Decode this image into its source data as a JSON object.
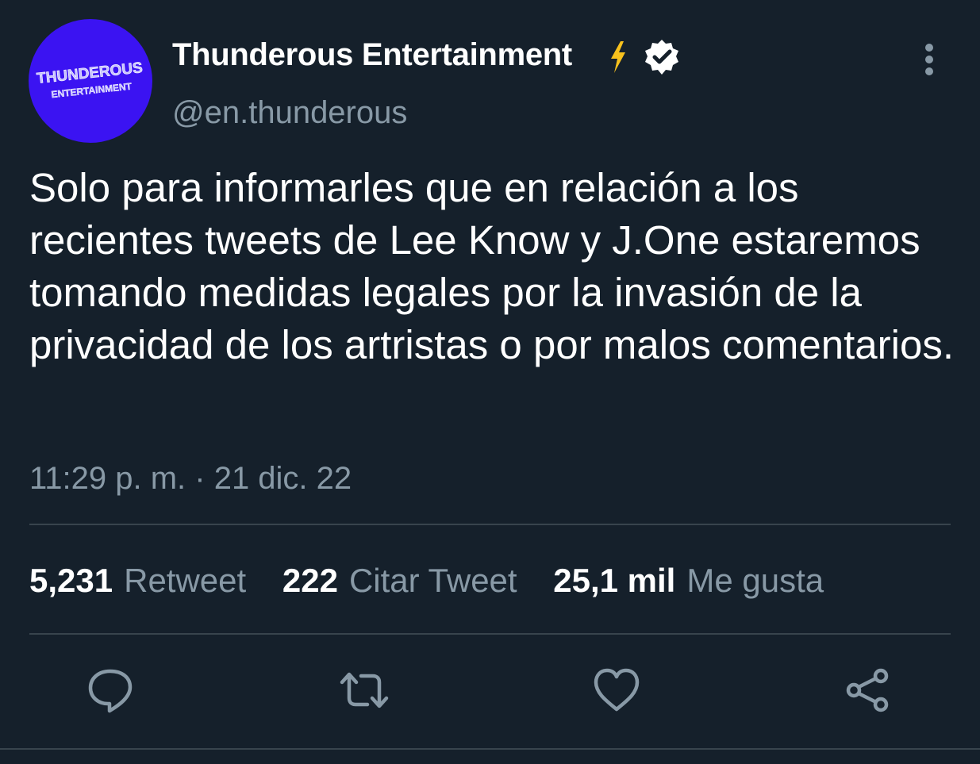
{
  "profile": {
    "avatar_text_line1": "THUNDEROUS",
    "avatar_text_line2": "ENTERTAINMENT",
    "display_name": "Thunderous Entertainment",
    "handle": "@en.thunderous",
    "badge_icons": [
      "lightning-icon",
      "verified-icon"
    ]
  },
  "tweet": {
    "text": "Solo para informarles que en relación a los recientes tweets de Lee Know y J.One estaremos tomando medidas legales por la invasión de la privacidad de los artristas o por malos comentarios.",
    "timestamp": "11:29 p. m. · 21 dic. 22"
  },
  "stats": {
    "retweets_count": "5,231",
    "retweets_label": "Retweet",
    "quotes_count": "222",
    "quotes_label": "Citar Tweet",
    "likes_count": "25,1 mil",
    "likes_label": "Me gusta"
  },
  "actions": [
    "reply-icon",
    "retweet-icon",
    "like-icon",
    "share-icon"
  ],
  "colors": {
    "background": "#15202b",
    "text_primary": "#ffffff",
    "text_secondary": "#8899a6",
    "divider": "#38444d",
    "avatar_bg": "#3b13f2",
    "bolt": "#f7c11d"
  }
}
